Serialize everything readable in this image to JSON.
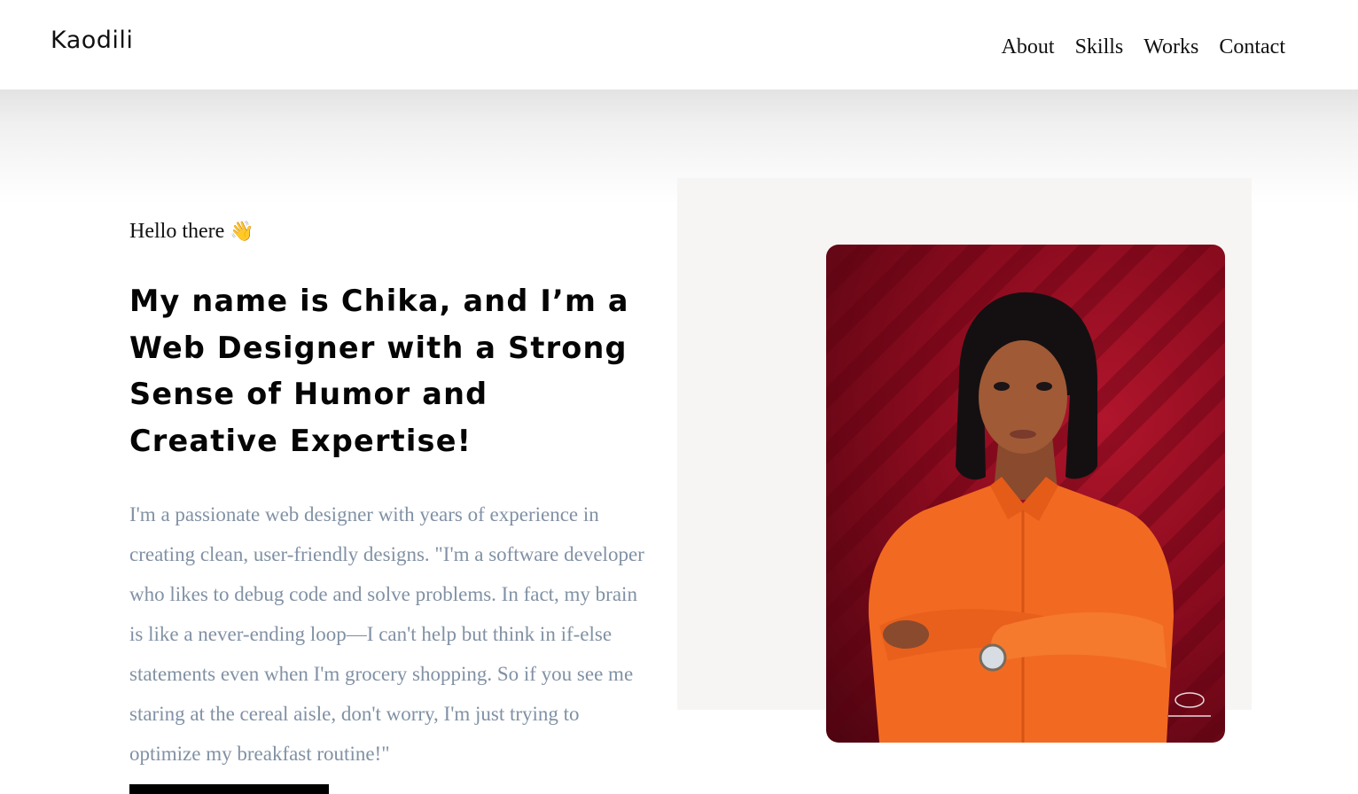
{
  "header": {
    "logo": "Kaodili",
    "nav": [
      "About",
      "Skills",
      "Works",
      "Contact"
    ]
  },
  "hero": {
    "greeting": "Hello there",
    "greeting_icon": "waving-hand-icon",
    "headline": "My name is Chika, and I’m a Web Designer with a Strong Sense of Humor and Creative Expertise!",
    "bio": "I'm a passionate web designer with years of experience in creating clean, user-friendly designs. \"I'm a software developer who likes to debug code and solve problems. In fact, my brain is like a never-ending loop—I can't help but think in if-else statements even when I'm grocery shopping. So if you see me staring at the cereal aisle, don't worry, I'm just trying to optimize my breakfast routine!\""
  },
  "colors": {
    "bio_text": "#8191a4",
    "panel_bg": "#f6f5f4",
    "portrait_bg": "#8a0b1e",
    "shirt": "#f26a22"
  }
}
